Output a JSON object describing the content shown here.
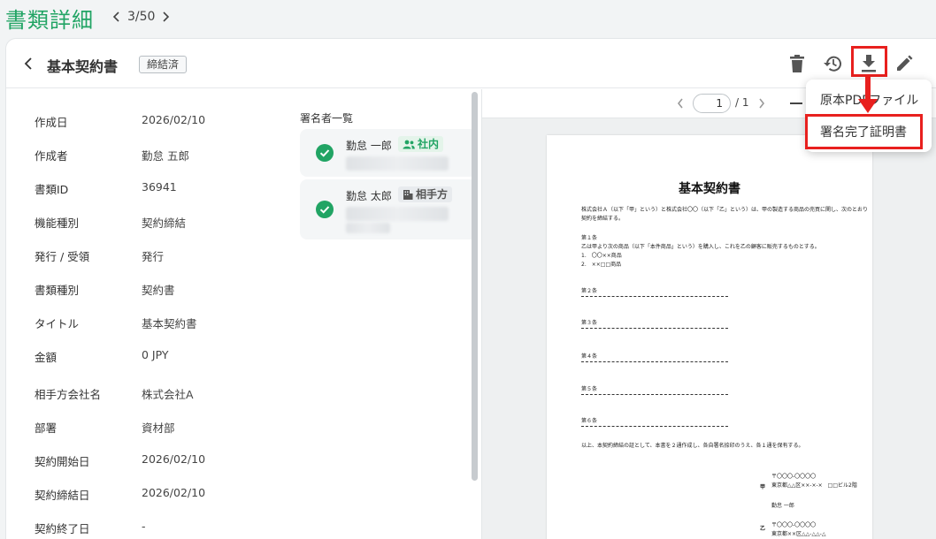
{
  "header": {
    "title": "書類詳細",
    "pager": "3/50"
  },
  "document": {
    "title": "基本契約書",
    "status": "締結済"
  },
  "details": [
    {
      "label": "作成日",
      "value": "2026/02/10"
    },
    {
      "label": "作成者",
      "value": "勤怠 五郎"
    },
    {
      "label": "書類ID",
      "value": "36941"
    },
    {
      "label": "機能種別",
      "value": "契約締結"
    },
    {
      "label": "発行 / 受領",
      "value": "発行"
    },
    {
      "label": "書類種別",
      "value": "契約書"
    },
    {
      "label": "タイトル",
      "value": "基本契約書"
    },
    {
      "label": "金額",
      "value": "0 JPY"
    },
    {
      "label": "相手方会社名",
      "value": "株式会社A"
    },
    {
      "label": "部署",
      "value": "資材部"
    },
    {
      "label": "契約開始日",
      "value": "2026/02/10"
    },
    {
      "label": "契約締結日",
      "value": "2026/02/10"
    },
    {
      "label": "契約終了日",
      "value": "-"
    }
  ],
  "signers": {
    "title": "署名者一覧",
    "items": [
      {
        "name": "勤怠 一郎",
        "tag": "社内"
      },
      {
        "name": "勤怠 太郎",
        "tag": "相手方"
      }
    ]
  },
  "preview": {
    "page_current": "1",
    "page_total": "/ 1",
    "paper": {
      "title": "基本契約書",
      "intro1": "株式会社Ａ（以下「甲」という）と株式会社〇〇（以下「乙」という）は、甲の製造する商品の売買に関し、次のとおり",
      "intro2": "契約を締結する。",
      "art1": "第１条",
      "art1_text": "乙は甲より次の商品（以下「本件商品」という）を購入し、これを乙の顧客に販売するものとする。",
      "art1_item1": "1.　〇〇××商品",
      "art1_item2": "2.　××□□商品",
      "art2": "第２条",
      "art3": "第３条",
      "art4": "第４条",
      "art5": "第５条",
      "art6": "第６条",
      "closing": "以上、本契約締結の証として、本書を２通作成し、各自署名捺印のうえ、各１通を保有する。",
      "party_a_label": "甲",
      "party_a_zip": "〒〇〇〇-〇〇〇〇",
      "party_a_addr": "東京都△△区××-×-×　□□ビル2階",
      "party_a_name": "勤怠 一郎",
      "party_b_label": "乙",
      "party_b_zip": "〒〇〇〇-〇〇〇〇",
      "party_b_addr": "東京都××区△△-△△-△"
    }
  },
  "download_menu": {
    "items": [
      "原本PDFファイル",
      "署名完了証明書"
    ]
  },
  "colors": {
    "brand": "#21a464",
    "annotation": "#e8201e"
  }
}
